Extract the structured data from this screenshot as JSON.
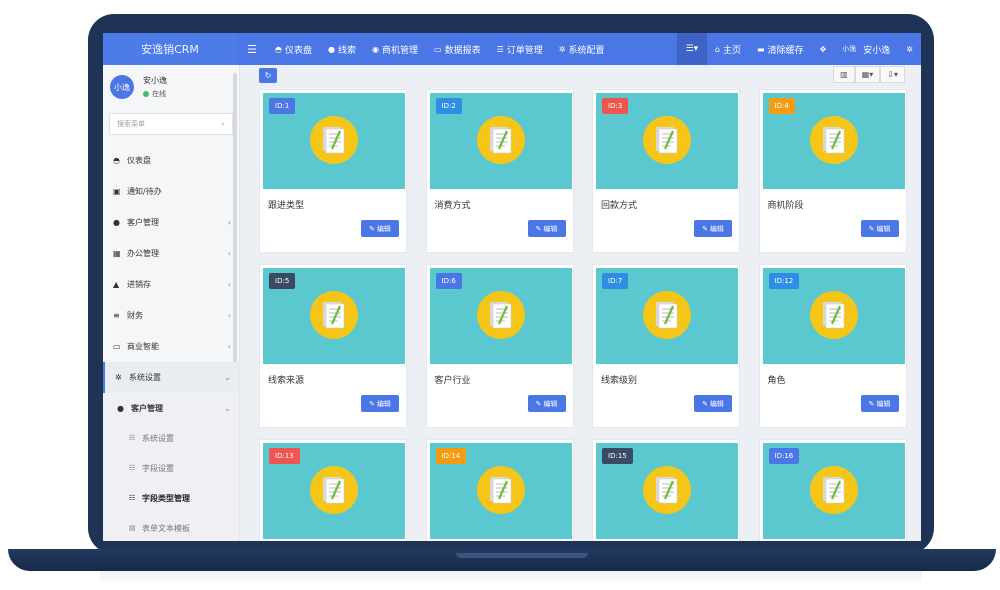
{
  "app": {
    "logo": "安逸销CRM",
    "accent": "#4a76e6"
  },
  "topnav": [
    {
      "icon": "dashboard-icon",
      "glyph": "◓",
      "label": "仪表盘"
    },
    {
      "icon": "person-icon",
      "glyph": "●",
      "label": "线索"
    },
    {
      "icon": "eye-icon",
      "glyph": "◉",
      "label": "商机管理"
    },
    {
      "icon": "laptop-icon",
      "glyph": "▭",
      "label": "数据报表"
    },
    {
      "icon": "list-icon",
      "glyph": "☰",
      "label": "订单管理"
    },
    {
      "icon": "gear-icon",
      "glyph": "✲",
      "label": "系统配置"
    }
  ],
  "topright": {
    "home": "主页",
    "clear_cache": "清除缓存",
    "avatar_text": "小逸",
    "user_name": "安小逸"
  },
  "sidebar": {
    "avatar": "小逸",
    "user_name": "安小逸",
    "status": "在线",
    "search_placeholder": "搜索菜单",
    "items": [
      {
        "label": "仪表盘",
        "glyph": "◓",
        "chevron": false
      },
      {
        "label": "通知/待办",
        "glyph": "▣",
        "chevron": false
      },
      {
        "label": "客户管理",
        "glyph": "●",
        "chevron": true
      },
      {
        "label": "办公管理",
        "glyph": "▦",
        "chevron": true
      },
      {
        "label": "进销存",
        "glyph": "▲",
        "chevron": true
      },
      {
        "label": "财务",
        "glyph": "≡",
        "chevron": true
      },
      {
        "label": "商业智能",
        "glyph": "▭",
        "chevron": true
      }
    ],
    "active_section": "系统设置",
    "sub_section": "客户管理",
    "sub_items": [
      {
        "label": "系统设置",
        "current": false
      },
      {
        "label": "字段设置",
        "current": false
      },
      {
        "label": "字段类型管理",
        "current": true
      },
      {
        "label": "表单文本模板",
        "current": false
      }
    ]
  },
  "edit_label": "编辑",
  "cards": [
    {
      "id": "ID:1",
      "title": "跟进类型",
      "badge_color": "#4a76e6"
    },
    {
      "id": "ID:2",
      "title": "消费方式",
      "badge_color": "#2f8de4"
    },
    {
      "id": "ID:3",
      "title": "回款方式",
      "badge_color": "#f0544e"
    },
    {
      "id": "ID:4",
      "title": "商机阶段",
      "badge_color": "#f39c12"
    },
    {
      "id": "ID:5",
      "title": "线索来源",
      "badge_color": "#3b4a63"
    },
    {
      "id": "ID:6",
      "title": "客户行业",
      "badge_color": "#4a76e6"
    },
    {
      "id": "ID:7",
      "title": "线索级别",
      "badge_color": "#2f8de4"
    },
    {
      "id": "ID:12",
      "title": "角色",
      "badge_color": "#2f8de4"
    },
    {
      "id": "ID:13",
      "title": "",
      "badge_color": "#f0544e"
    },
    {
      "id": "ID:14",
      "title": "",
      "badge_color": "#f39c12"
    },
    {
      "id": "ID:15",
      "title": "",
      "badge_color": "#3b4a63"
    },
    {
      "id": "ID:16",
      "title": "",
      "badge_color": "#4a76e6"
    }
  ]
}
